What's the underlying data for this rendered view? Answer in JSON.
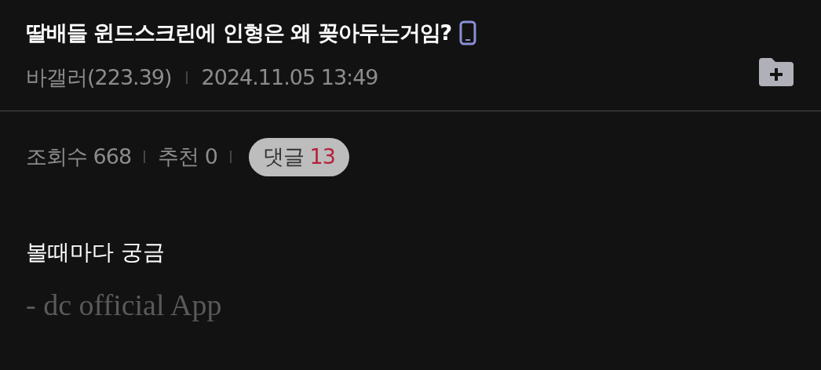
{
  "post": {
    "title": "딸배들 윈드스크린에 인형은 왜 꽂아두는거임?",
    "author": "바갤러(223.39)",
    "date": "2024.11.05 13:49"
  },
  "stats": [
    {
      "kind": "plain",
      "label": "조회수",
      "value": "668"
    },
    {
      "kind": "plain",
      "label": "추천",
      "value": "0"
    },
    {
      "kind": "pill",
      "label": "댓글",
      "value": "13"
    }
  ],
  "body": {
    "text": "볼때마다 궁금",
    "signature": "- dc official App"
  }
}
